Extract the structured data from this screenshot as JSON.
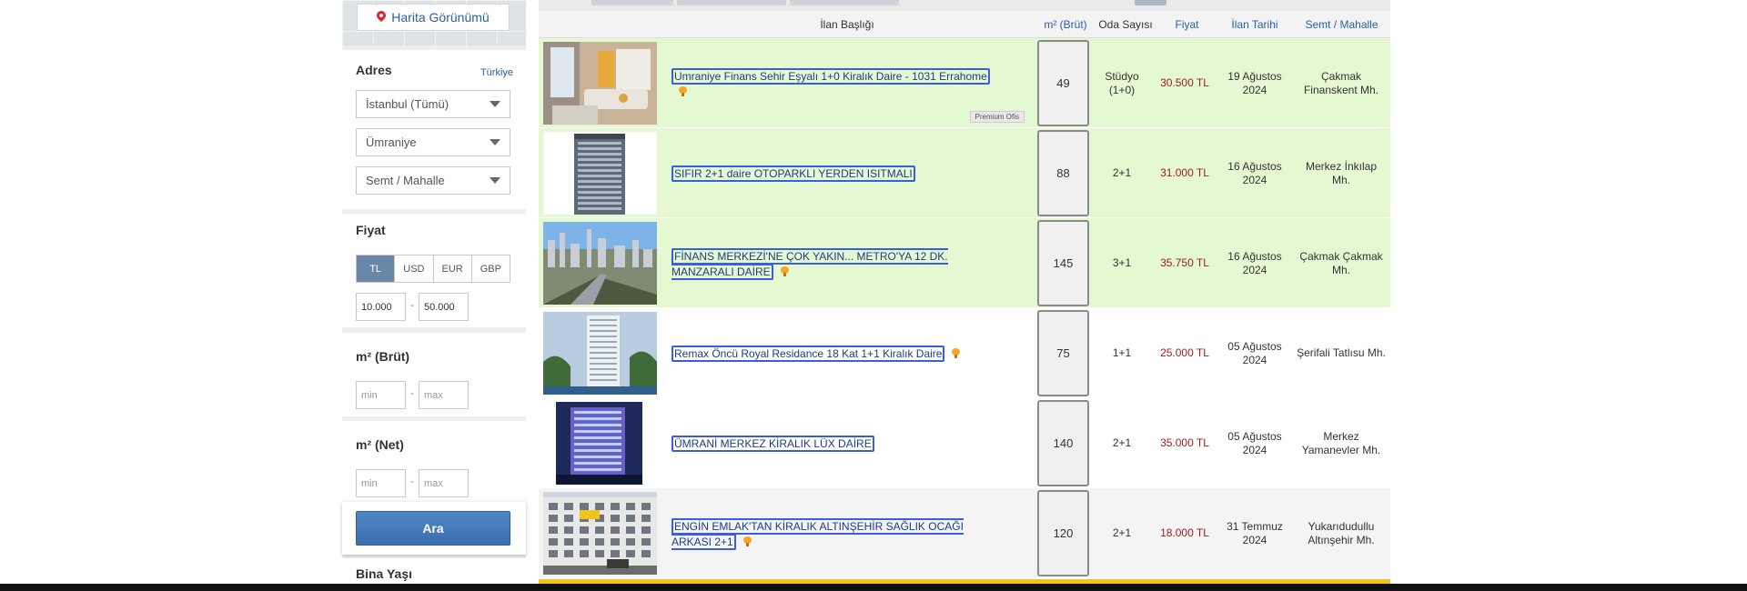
{
  "sidebar": {
    "map_button_label": "Harita Görünümü",
    "address": {
      "title": "Adres",
      "country_link": "Türkiye",
      "city": "İstanbul (Tümü)",
      "district": "Ümraniye",
      "neighborhood": "Semt / Mahalle"
    },
    "price": {
      "title": "Fiyat",
      "currencies": [
        "TL",
        "USD",
        "EUR",
        "GBP"
      ],
      "selected_currency": "TL",
      "min_value": "10.000",
      "max_value": "50.000"
    },
    "m2_brut": {
      "title": "m² (Brüt)",
      "min_placeholder": "min",
      "max_placeholder": "max"
    },
    "m2_net": {
      "title": "m² (Net)",
      "min_placeholder": "min",
      "max_placeholder": "max"
    },
    "range_dash": "-",
    "search_button": "Ara",
    "building_age_title": "Bina Yaşı"
  },
  "table": {
    "headers": [
      "İlan Başlığı",
      "m² (Brüt)",
      "Oda Sayısı",
      "Fiyat",
      "İlan Tarihi",
      "Semt / Mahalle"
    ],
    "premium_label": "Premium Ofis",
    "rows": [
      {
        "title": "Umraniye Finans Sehir Eşyalı 1+0 Kiralık Daire - 1031 Errahome",
        "m2": "49",
        "rooms": "Stüdyo (1+0)",
        "price": "30.500 TL",
        "date": "19 Ağustos 2024",
        "location": "Çakmak Finanskent Mh.",
        "featured": true,
        "premium": true,
        "bulb": true
      },
      {
        "title": "SIFIR 2+1 daire OTOPARKLI YERDEN ISITMALI",
        "m2": "88",
        "rooms": "2+1",
        "price": "31.000 TL",
        "date": "16 Ağustos 2024",
        "location": "Merkez İnkılap Mh.",
        "featured": true,
        "premium": false,
        "bulb": false
      },
      {
        "title": "FİNANS MERKEZİ'NE ÇOK YAKIN... METRO'YA 12 DK. MANZARALI DAİRE",
        "m2": "145",
        "rooms": "3+1",
        "price": "35.750 TL",
        "date": "16 Ağustos 2024",
        "location": "Çakmak Çakmak Mh.",
        "featured": true,
        "premium": false,
        "bulb": true
      },
      {
        "title": "Remax Öncü Royal Residance 18 Kat 1+1 Kiralık Daire",
        "m2": "75",
        "rooms": "1+1",
        "price": "25.000 TL",
        "date": "05 Ağustos 2024",
        "location": "Şerifali Tatlısu Mh.",
        "featured": false,
        "premium": false,
        "bulb": true
      },
      {
        "title": "ÜMRANİ MERKEZ KİRALIK LÜX DAİRE",
        "m2": "140",
        "rooms": "2+1",
        "price": "35.000 TL",
        "date": "05 Ağustos 2024",
        "location": "Merkez Yamanevler Mh.",
        "featured": false,
        "premium": false,
        "bulb": false
      },
      {
        "title": "ENGİN EMLAK'TAN KİRALIK ALTINŞEHİR SAĞLIK OCAĞI ARKASI 2+1",
        "m2": "120",
        "rooms": "2+1",
        "price": "18.000 TL",
        "date": "31 Temmuz 2024",
        "location": "Yukarıdudullu Altınşehir Mh.",
        "featured": false,
        "premium": false,
        "bulb": true
      }
    ]
  },
  "colors": {
    "featured_row": "#e4f8d2",
    "price": "#9b1c1c",
    "link": "#2a5ea8",
    "search_button": "#3a6fad",
    "highlight_bar": "#f5c518"
  }
}
